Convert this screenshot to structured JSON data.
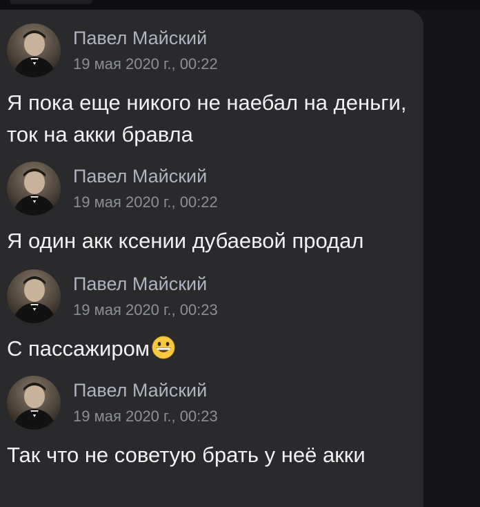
{
  "messages": [
    {
      "sender": "Павел Майский",
      "date": "19 мая 2020 г., 00:22",
      "text": "Я пока еще никого не наебал на деньги, ток на акки бравла"
    },
    {
      "sender": "Павел Майский",
      "date": "19 мая 2020 г., 00:22",
      "text": "Я один акк ксении дубаевой продал"
    },
    {
      "sender": "Павел Майский",
      "date": "19 мая 2020 г., 00:23",
      "text": "С пассажиром",
      "emoji": "grinning-face-emoji"
    },
    {
      "sender": "Павел Майский",
      "date": "19 мая 2020 г., 00:23",
      "text": "Так что не советую брать у неё акки"
    }
  ],
  "colors": {
    "background": "#141416",
    "panel": "#2a2a2d",
    "sender": "#aeb4c0",
    "date": "#8b8f97",
    "text": "#f2f2f4"
  }
}
